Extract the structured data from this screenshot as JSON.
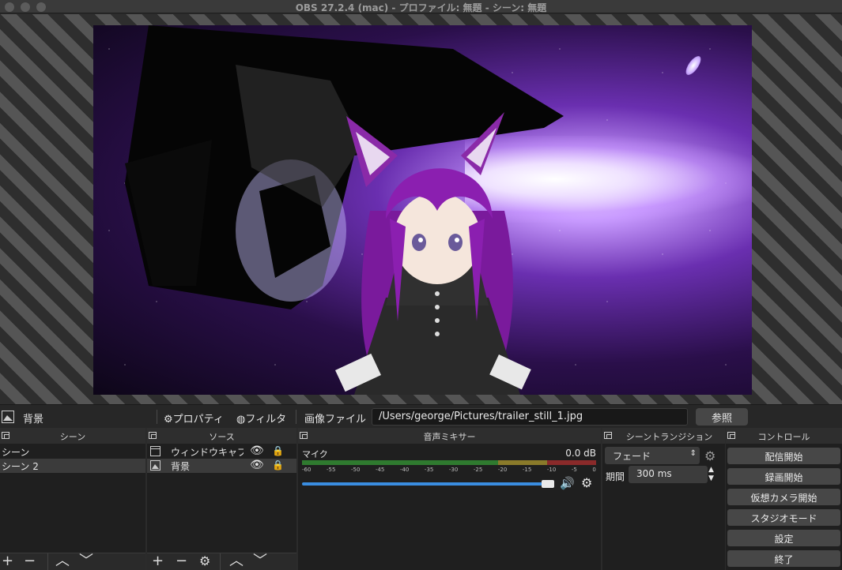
{
  "window": {
    "title": "OBS 27.2.4 (mac) - プロファイル: 無題 - シーン: 無題"
  },
  "source_toolbar": {
    "selected_source": "背景",
    "properties_label": "プロパティ",
    "filters_label": "フィルタ",
    "image_file_label": "画像ファイル",
    "image_path": "/Users/george/Pictures/trailer_still_1.jpg",
    "browse_label": "参照"
  },
  "scenes": {
    "title": "シーン",
    "items": [
      "シーン",
      "シーン 2"
    ]
  },
  "sources": {
    "title": "ソース",
    "items": [
      {
        "label": "ウィンドウキャプ",
        "icon": "window-icon"
      },
      {
        "label": "背景",
        "icon": "image-icon"
      }
    ]
  },
  "mixer": {
    "title": "音声ミキサー",
    "track": "マイク",
    "level": "0.0 dB",
    "scale": [
      "-60",
      "-55",
      "-50",
      "-45",
      "-40",
      "-35",
      "-30",
      "-25",
      "-20",
      "-15",
      "-10",
      "-5",
      "0"
    ]
  },
  "transitions": {
    "title": "シーントランジション",
    "type": "フェード",
    "duration_label": "期間",
    "duration": "300 ms"
  },
  "controls": {
    "title": "コントロール",
    "buttons": [
      "配信開始",
      "録画開始",
      "仮想カメラ開始",
      "スタジオモード",
      "設定",
      "終了"
    ]
  }
}
